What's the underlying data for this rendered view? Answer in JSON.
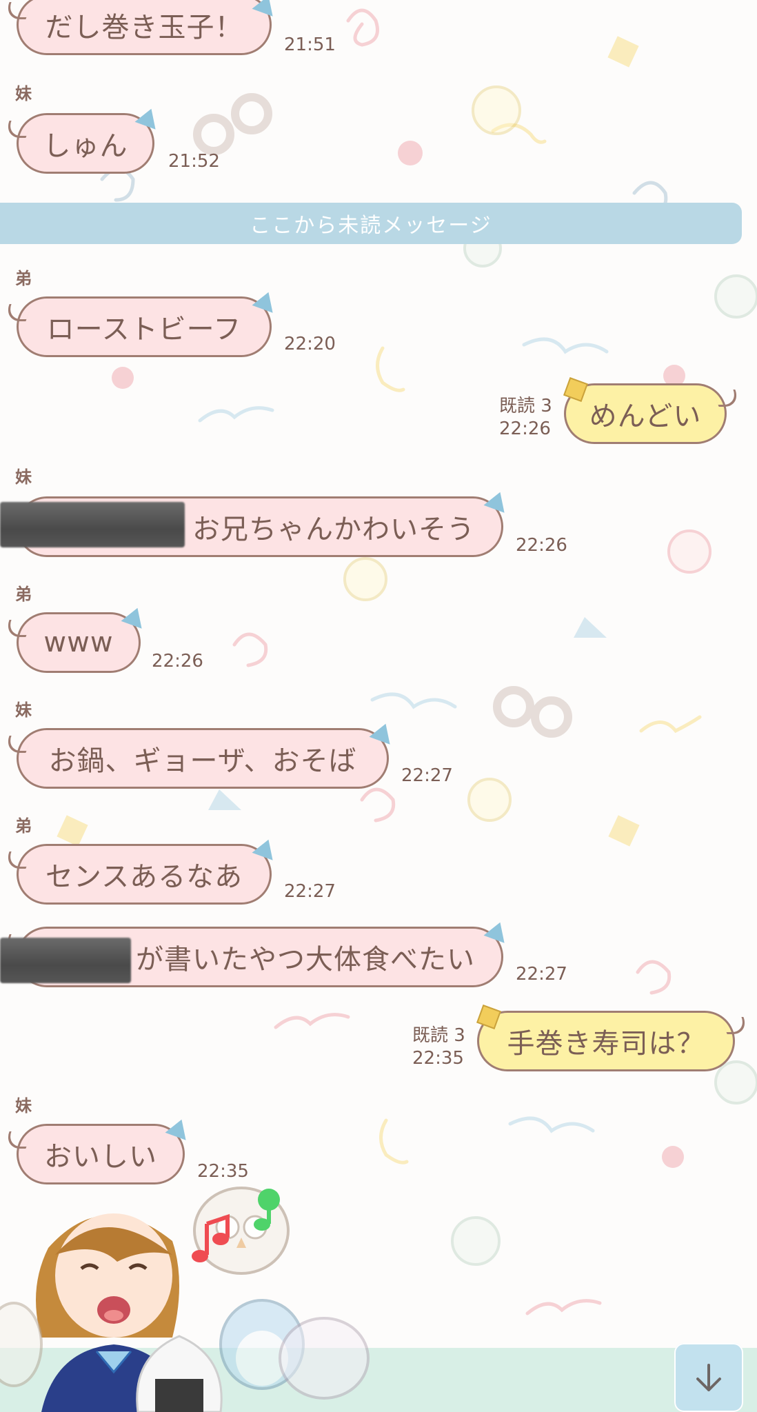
{
  "chat": {
    "messages": [
      {
        "id": "m1",
        "sender": "",
        "text": "だし巻き玉子！",
        "time": "21:51",
        "side": "left"
      },
      {
        "id": "m2",
        "sender": "妹",
        "text": "しゅん",
        "time": "21:52",
        "side": "left"
      },
      {
        "id": "m3",
        "sender": "弟",
        "text": "ローストビーフ",
        "time": "22:20",
        "side": "left"
      },
      {
        "id": "m4",
        "sender": "",
        "text": "めんどい",
        "time": "22:26",
        "side": "right",
        "read": "既読 3"
      },
      {
        "id": "m5",
        "sender": "妹",
        "text": "お兄ちゃんかわいそう",
        "time": "22:26",
        "side": "left",
        "redacted": true
      },
      {
        "id": "m6",
        "sender": "弟",
        "text": "www",
        "time": "22:26",
        "side": "left"
      },
      {
        "id": "m7",
        "sender": "妹",
        "text": "お鍋、ギョーザ、おそば",
        "time": "22:27",
        "side": "left"
      },
      {
        "id": "m8",
        "sender": "弟",
        "text": "センスあるなあ",
        "time": "22:27",
        "side": "left"
      },
      {
        "id": "m9",
        "sender": "",
        "text": "が書いたやつ大体食べたい",
        "time": "22:27",
        "side": "left",
        "redacted": true
      },
      {
        "id": "m10",
        "sender": "",
        "text": "手巻き寿司は？",
        "time": "22:35",
        "side": "right",
        "read": "既読 3"
      },
      {
        "id": "m11",
        "sender": "妹",
        "text": "おいしい",
        "time": "22:35",
        "side": "left"
      }
    ],
    "unread_divider": "ここから未読メッセージ"
  },
  "icons": {
    "scroll_down": "arrow-down-icon"
  },
  "colors": {
    "left_bubble": "#fde3e4",
    "right_bubble": "#fdf1a5",
    "bubble_border": "#a07d72",
    "divider": "#b9d8e5",
    "accent_triangle": "#8fc4dc",
    "accent_square": "#f2cd5b"
  }
}
